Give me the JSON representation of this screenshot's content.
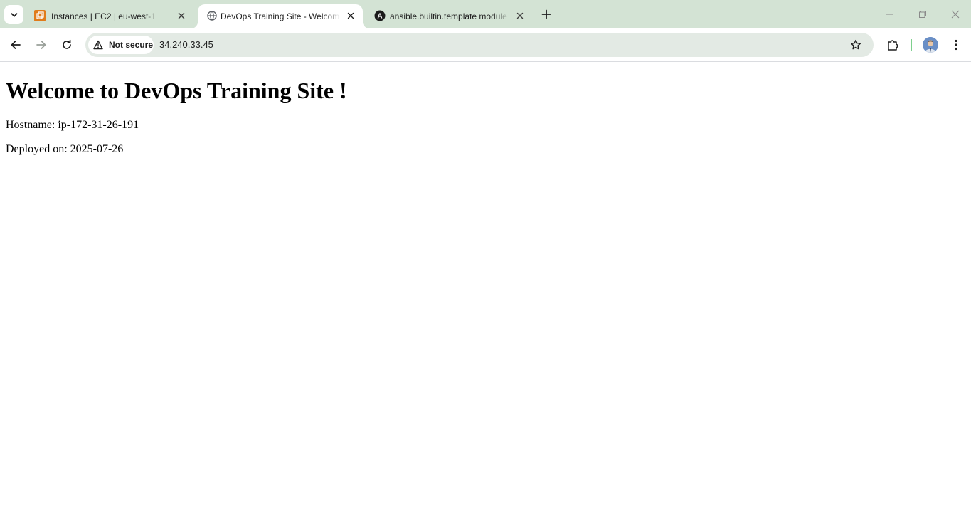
{
  "browser": {
    "tabs": [
      {
        "title": "Instances | EC2 | eu-west-1",
        "favicon": "aws-ec2-icon",
        "active": false
      },
      {
        "title": "DevOps Training Site - Welcome",
        "favicon": "globe-icon",
        "active": true
      },
      {
        "title": "ansible.builtin.template module",
        "favicon": "ansible-icon",
        "active": false
      }
    ],
    "security_label": "Not secure",
    "url": "34.240.33.45",
    "ansible_favicon_letter": "A"
  },
  "page": {
    "heading": "Welcome to DevOps Training Site !",
    "hostname_line": "Hostname: ip-172-31-26-191",
    "deployed_line": "Deployed on: 2025-07-26"
  },
  "colors": {
    "tabstrip_bg": "#d3e3d4",
    "omnibox_bg": "#e3eae4",
    "aws_orange": "#e07b1a",
    "divider_green": "#7ed08e"
  }
}
